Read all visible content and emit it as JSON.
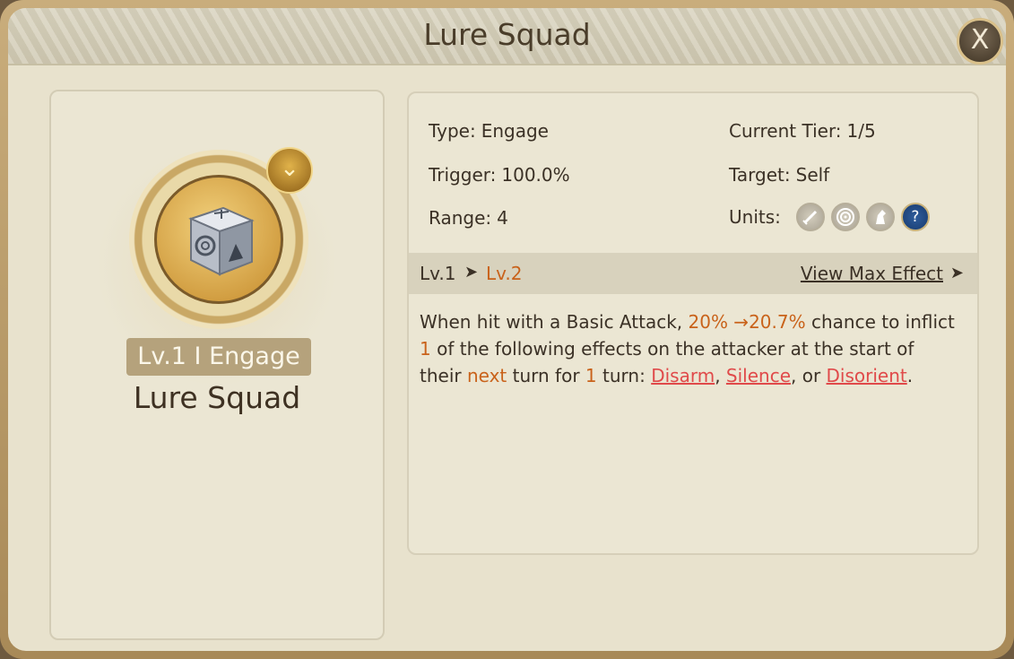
{
  "dialog": {
    "title": "Lure Squad",
    "close_label": "X"
  },
  "skill": {
    "level_type": "Lv.1 I Engage",
    "name": "Lure Squad"
  },
  "stats": {
    "type_label": "Type:",
    "type_value": "Engage",
    "tier_label": "Current Tier:",
    "tier_value": "1/5",
    "trigger_label": "Trigger:",
    "trigger_value": "100.0%",
    "target_label": "Target:",
    "target_value": "Self",
    "range_label": "Range:",
    "range_value": "4",
    "units_label": "Units:",
    "units": [
      {
        "icon": "sword-icon",
        "active": false
      },
      {
        "icon": "bow-target-icon",
        "active": false
      },
      {
        "icon": "horse-icon",
        "active": false
      },
      {
        "icon": "question-icon",
        "active": true,
        "glyph": "?"
      }
    ]
  },
  "level_bar": {
    "from": "Lv.1",
    "arrow": "➤",
    "to": "Lv.2",
    "view_max": "View Max Effect",
    "view_arrow": "➤"
  },
  "description": {
    "p1": "When hit with a Basic Attack, ",
    "chance": "20% →20.7%",
    "p2": " chance to inflict ",
    "count": "1",
    "p3": " of the following effects on the attacker at the start of their ",
    "next": "next",
    "p4": " turn for ",
    "turns": "1",
    "p5": " turn: ",
    "effect1": "Disarm",
    "sep1": ", ",
    "effect2": "Silence",
    "sep2": ", or ",
    "effect3": "Disorient",
    "end": "."
  },
  "colors": {
    "highlight": "#c9621a",
    "link": "#e04a4a",
    "panel_bg": "#e8e2cd"
  }
}
